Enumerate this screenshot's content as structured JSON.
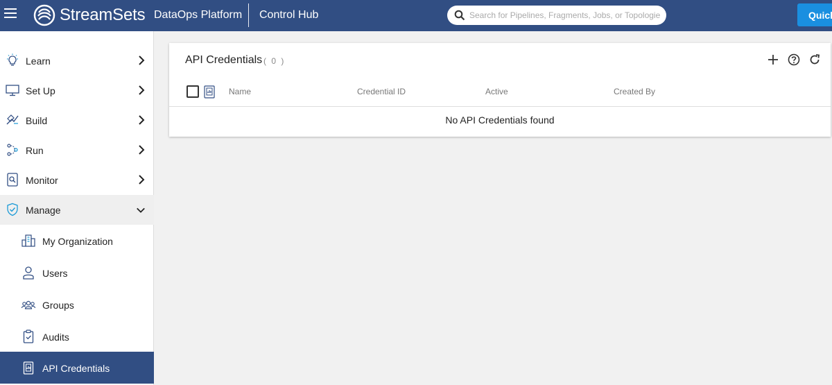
{
  "header": {
    "brand": "StreamSets",
    "platform": "DataOps Platform",
    "product": "Control Hub",
    "search_placeholder": "Search for Pipelines, Fragments, Jobs, or Topologies",
    "quick_label": "Quick",
    "color": "#314e83"
  },
  "sidebar": {
    "items": [
      {
        "label": "Learn",
        "icon": "lightbulb-icon"
      },
      {
        "label": "Set Up",
        "icon": "monitor-icon"
      },
      {
        "label": "Build",
        "icon": "build-icon"
      },
      {
        "label": "Run",
        "icon": "run-icon"
      },
      {
        "label": "Monitor",
        "icon": "monitor-search-icon"
      },
      {
        "label": "Manage",
        "icon": "shield-check-icon",
        "expanded": true
      }
    ],
    "sub_items": [
      {
        "label": "My Organization",
        "icon": "building-icon"
      },
      {
        "label": "Users",
        "icon": "user-icon"
      },
      {
        "label": "Groups",
        "icon": "group-icon"
      },
      {
        "label": "Audits",
        "icon": "clipboard-check-icon"
      },
      {
        "label": "API Credentials",
        "icon": "api-document-icon",
        "active": true
      }
    ]
  },
  "main": {
    "title": "API Credentials",
    "count": "( 0 )",
    "columns": [
      "Name",
      "Credential ID",
      "Active",
      "Created By"
    ],
    "empty_message": "No API Credentials found"
  }
}
